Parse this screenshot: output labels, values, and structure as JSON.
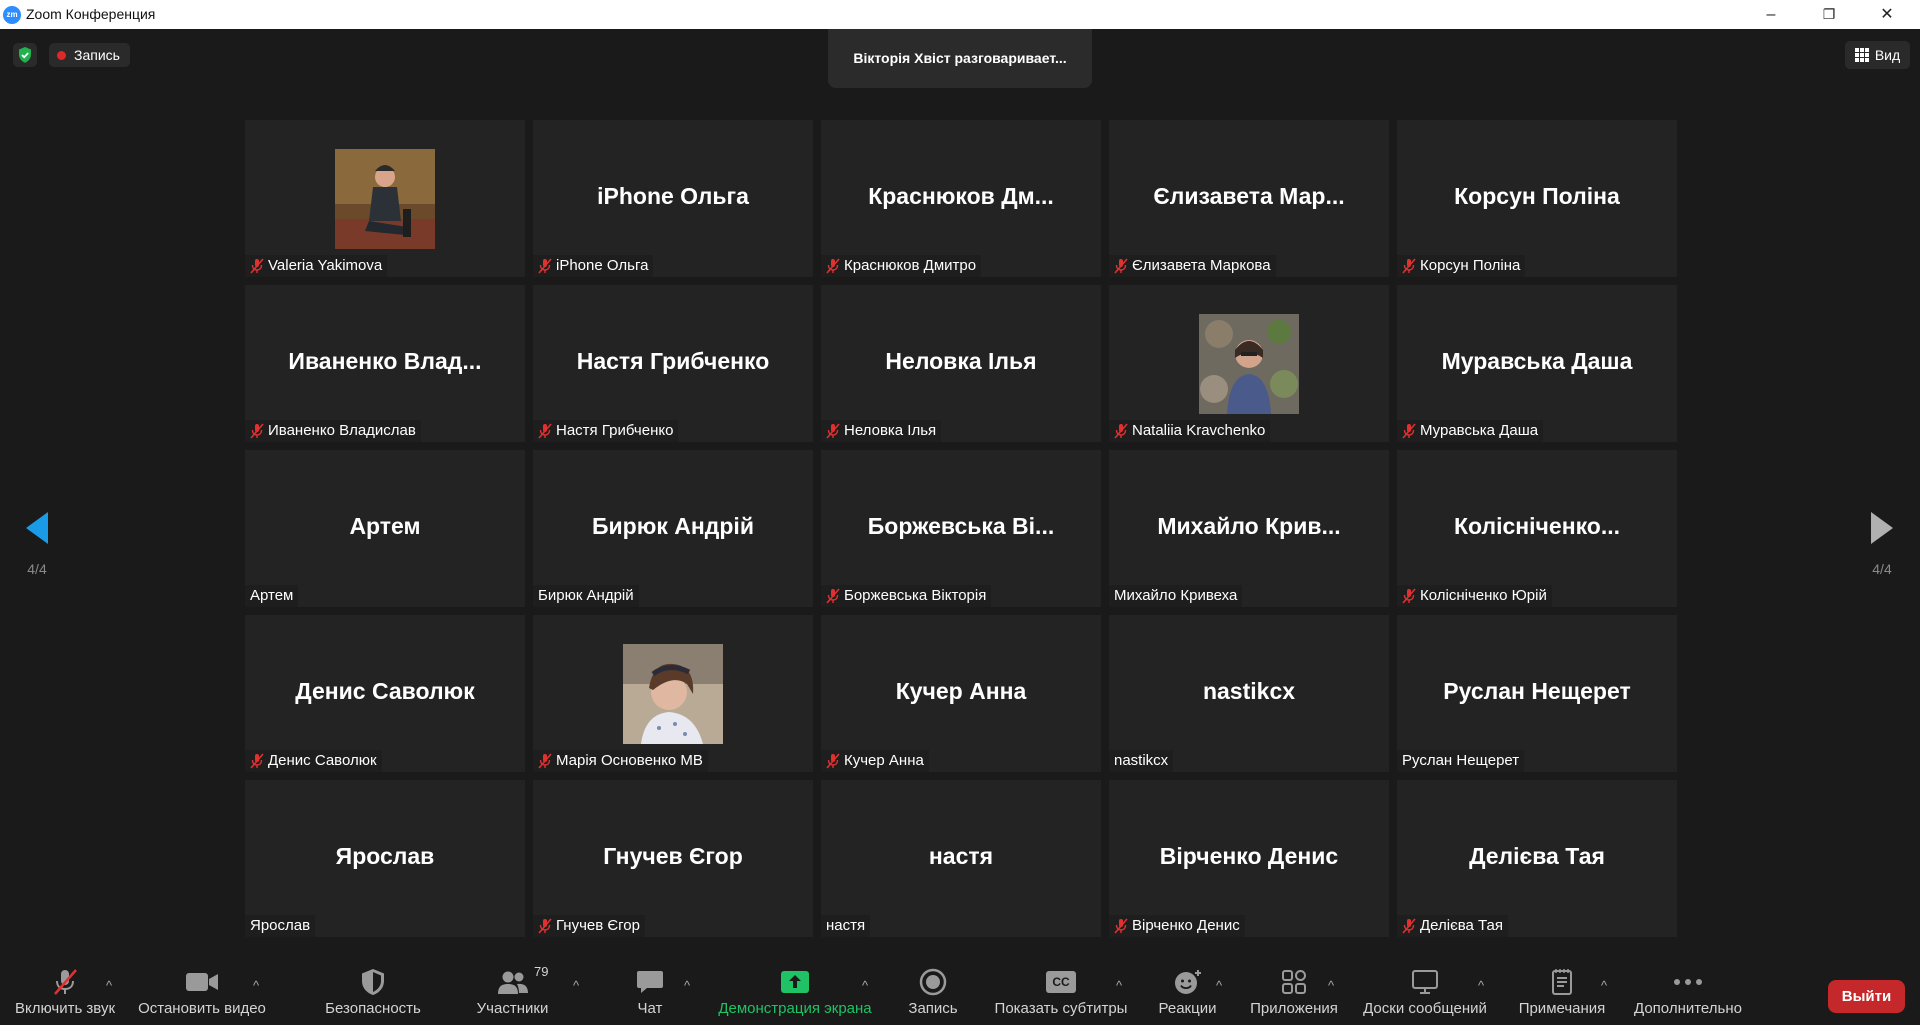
{
  "window": {
    "title": "Zoom Конференция",
    "app_icon_text": "zm",
    "minimize": "–",
    "restore": "❐",
    "close": "✕"
  },
  "topbar": {
    "recording_label": "Запись",
    "speaker_toast": "Вікторія Хвіст разговаривает...",
    "view_label": "Вид"
  },
  "pagination": {
    "left_label": "4/4",
    "right_label": "4/4"
  },
  "participants": [
    {
      "display": "",
      "tag": "Valeria Yakimova",
      "muted": true,
      "photo": "woman-sitting-outdoors-autumn"
    },
    {
      "display": "iPhone Ольга",
      "tag": "iPhone Ольга",
      "muted": true
    },
    {
      "display": "Краснюков Дм...",
      "tag": "Краснюков Дмитро",
      "muted": true
    },
    {
      "display": "Єлизавета  Мар...",
      "tag": "Єлизавета Маркова",
      "muted": true
    },
    {
      "display": "Корсун Поліна",
      "tag": "Корсун Поліна",
      "muted": true
    },
    {
      "display": "Иваненко  Влад...",
      "tag": "Иваненко Владислав",
      "muted": true
    },
    {
      "display": "Настя Грибченко",
      "tag": "Настя Грибченко",
      "muted": true
    },
    {
      "display": "Неловка Ілья",
      "tag": "Неловка Ілья",
      "muted": true
    },
    {
      "display": "",
      "tag": "Nataliia Kravchenko",
      "muted": true,
      "photo": "woman-portrait-garden"
    },
    {
      "display": "Муравська Даша",
      "tag": "Муравська Даша",
      "muted": true
    },
    {
      "display": "Артем",
      "tag": "Артем",
      "muted": false
    },
    {
      "display": "Бирюк Андрій",
      "tag": "Бирюк Андрій",
      "muted": false
    },
    {
      "display": "Боржевська  Ві...",
      "tag": "Боржевська Вікторія",
      "muted": true
    },
    {
      "display": "Михайло  Крив...",
      "tag": "Михайло Кривеха",
      "muted": false
    },
    {
      "display": "Колісніченко...",
      "tag": "Колісніченко Юрій",
      "muted": true
    },
    {
      "display": "Денис Саволюк",
      "tag": "Денис Саволюк",
      "muted": true
    },
    {
      "display": "",
      "tag": "Марія Основенко МВ",
      "muted": true,
      "photo": "girl-with-headband"
    },
    {
      "display": "Кучер Анна",
      "tag": "Кучер Анна",
      "muted": true
    },
    {
      "display": "nastikcx",
      "tag": "nastikcx",
      "muted": false
    },
    {
      "display": "Руслан Нещерет",
      "tag": "Руслан Нещерет",
      "muted": false
    },
    {
      "display": "Ярослав",
      "tag": "Ярослав",
      "muted": false
    },
    {
      "display": "Гнучев Єгор",
      "tag": "Гнучев Єгор",
      "muted": true
    },
    {
      "display": "настя",
      "tag": "настя",
      "muted": false
    },
    {
      "display": "Вірченко Денис",
      "tag": "Вірченко Денис",
      "muted": true
    },
    {
      "display": "Делієва Тая",
      "tag": "Делієва Тая",
      "muted": true
    }
  ],
  "toolbar": {
    "unmute": "Включить звук",
    "stop_video": "Остановить видео",
    "security": "Безопасность",
    "participants": "Участники",
    "participants_count": "79",
    "chat": "Чат",
    "share_screen": "Демонстрация экрана",
    "record": "Запись",
    "captions": "Показать субтитры",
    "captions_icon_text": "CC",
    "reactions": "Реакции",
    "apps": "Приложения",
    "whiteboards": "Доски сообщений",
    "notes": "Примечания",
    "more": "Дополнительно",
    "caret": "^",
    "leave": "Выйти"
  },
  "colors": {
    "background": "#1a1a1a",
    "tile": "#232323",
    "muted_icon": "#e03030",
    "share_green": "#1fc264",
    "leave_red": "#c5282a",
    "accent_blue": "#2d8cff"
  }
}
